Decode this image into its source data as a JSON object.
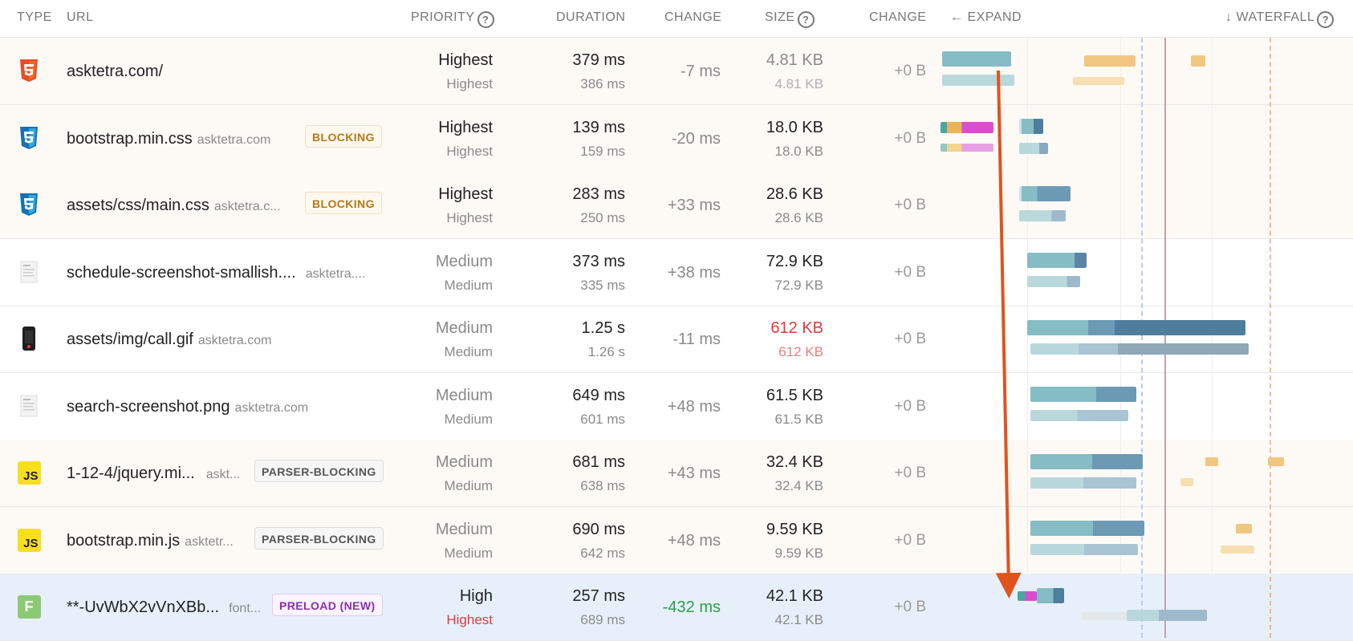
{
  "header": {
    "type": "TYPE",
    "url": "URL",
    "priority": "PRIORITY",
    "duration": "DURATION",
    "change": "CHANGE",
    "size": "SIZE",
    "size_change": "CHANGE",
    "expand": "← EXPAND",
    "waterfall": "↓ WATERFALL",
    "help_glyph": "?"
  },
  "rows": [
    {
      "icon": "html-icon",
      "icon_text": "5",
      "url": "asktetra.com/",
      "domain": "",
      "badge": "",
      "priority": "Highest",
      "priority_prev": "Highest",
      "duration": "379 ms",
      "duration_prev": "386 ms",
      "change": "-7 ms",
      "size": "4.81 KB",
      "size_prev": "4.81 KB",
      "size_change": "+0 B"
    },
    {
      "icon": "css-icon",
      "icon_text": "3",
      "url": "bootstrap.min.css",
      "domain": "asktetra.com",
      "badge": "BLOCKING",
      "priority": "Highest",
      "priority_prev": "Highest",
      "duration": "139 ms",
      "duration_prev": "159 ms",
      "change": "-20 ms",
      "size": "18.0 KB",
      "size_prev": "18.0 KB",
      "size_change": "+0 B"
    },
    {
      "icon": "css-icon",
      "icon_text": "3",
      "url": "assets/css/main.css",
      "domain": "asktetra.c...",
      "badge": "BLOCKING",
      "priority": "Highest",
      "priority_prev": "Highest",
      "duration": "283 ms",
      "duration_prev": "250 ms",
      "change": "+33 ms",
      "size": "28.6 KB",
      "size_prev": "28.6 KB",
      "size_change": "+0 B"
    },
    {
      "icon": "image-thumbnail-icon",
      "icon_text": "",
      "url": "schedule-screenshot-smallish....",
      "domain": "asktetra....",
      "badge": "",
      "priority": "Medium",
      "priority_prev": "Medium",
      "duration": "373 ms",
      "duration_prev": "335 ms",
      "change": "+38 ms",
      "size": "72.9 KB",
      "size_prev": "72.9 KB",
      "size_change": "+0 B"
    },
    {
      "icon": "gif-thumbnail-icon",
      "icon_text": "",
      "url": "assets/img/call.gif",
      "domain": "asktetra.com",
      "badge": "",
      "priority": "Medium",
      "priority_prev": "Medium",
      "duration": "1.25 s",
      "duration_prev": "1.26 s",
      "change": "-11 ms",
      "size": "612 KB",
      "size_prev": "612 KB",
      "size_change": "+0 B"
    },
    {
      "icon": "image-thumbnail-icon",
      "icon_text": "",
      "url": "search-screenshot.png",
      "domain": "asktetra.com",
      "badge": "",
      "priority": "Medium",
      "priority_prev": "Medium",
      "duration": "649 ms",
      "duration_prev": "601 ms",
      "change": "+48 ms",
      "size": "61.5 KB",
      "size_prev": "61.5 KB",
      "size_change": "+0 B"
    },
    {
      "icon": "js-icon",
      "icon_text": "JS",
      "url": "1-12-4/jquery.mi...",
      "domain": "askt...",
      "badge": "PARSER-BLOCKING",
      "priority": "Medium",
      "priority_prev": "Medium",
      "duration": "681 ms",
      "duration_prev": "638 ms",
      "change": "+43 ms",
      "size": "32.4 KB",
      "size_prev": "32.4 KB",
      "size_change": "+0 B"
    },
    {
      "icon": "js-icon",
      "icon_text": "JS",
      "url": "bootstrap.min.js",
      "domain": "asktetr...",
      "badge": "PARSER-BLOCKING",
      "priority": "Medium",
      "priority_prev": "Medium",
      "duration": "690 ms",
      "duration_prev": "642 ms",
      "change": "+48 ms",
      "size": "9.59 KB",
      "size_prev": "9.59 KB",
      "size_change": "+0 B"
    },
    {
      "icon": "font-icon",
      "icon_text": "F",
      "url": "**-UvWbX2vVnXBb...",
      "domain": "font...",
      "badge": "PRELOAD (NEW)",
      "priority": "High",
      "priority_prev": "Highest",
      "duration": "257 ms",
      "duration_prev": "689 ms",
      "change": "-432 ms",
      "size": "42.1 KB",
      "size_prev": "42.1 KB",
      "size_change": "+0 B"
    }
  ],
  "colors": {
    "accent_arrow": "#e0531c",
    "request_bar": "#86bcc4",
    "download_bar": "#4f7e9c",
    "render_line": "#c9a0a8",
    "blocking_badge": "#b17a1a",
    "preload_badge": "#8a2fb0",
    "good_change": "#2aa044",
    "bad_size": "#e0393e"
  }
}
